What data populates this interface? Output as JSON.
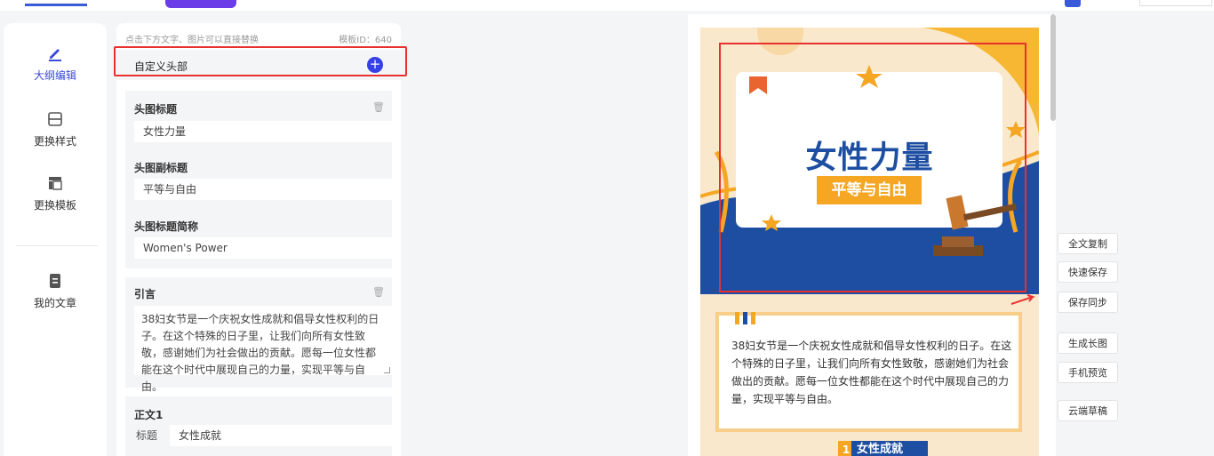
{
  "nav": {
    "items": [
      {
        "label": "大纲编辑",
        "icon": "pencil-icon"
      },
      {
        "label": "更换样式",
        "icon": "layout-rows-icon"
      },
      {
        "label": "更换模板",
        "icon": "template-icon"
      },
      {
        "label": "我的文章",
        "icon": "document-icon"
      }
    ]
  },
  "editor": {
    "hint": "点击下方文字、图片可以直接替换",
    "template_id": "模板ID：640",
    "custom_header_label": "自定义头部",
    "hero": {
      "title_label": "头图标题",
      "title_value": "女性力量",
      "subtitle_label": "头图副标题",
      "subtitle_value": "平等与自由",
      "abbr_label": "头图标题简称",
      "abbr_value": "Women's Power"
    },
    "intro": {
      "label": "引言",
      "value": "38妇女节是一个庆祝女性成就和倡导女性权利的日子。在这个特殊的日子里，让我们向所有女性致敬，感谢她们为社会做出的贡献。愿每一位女性都能在这个时代中展现自己的力量，实现平等与自由。"
    },
    "body1": {
      "label": "正文1",
      "field_label": "标题",
      "field_value": "女性成就"
    }
  },
  "preview": {
    "hero_title": "女性力量",
    "hero_subtitle": "平等与自由",
    "intro_text": "38妇女节是一个庆祝女性成就和倡导女性权利的日子。在这个特殊的日子里，让我们向所有女性致敬，感谢她们为社会做出的贡献。愿每一位女性都能在这个时代中展现自己的力量，实现平等与自由。",
    "section_num": "1",
    "section_title": "女性成就"
  },
  "actions": [
    "全文复制",
    "快速保存",
    "保存同步",
    "生成长图",
    "手机预览",
    "云端草稿"
  ],
  "colors": {
    "accent": "#3640e8",
    "highlight_border": "#e8312f",
    "brand_blue": "#1d4ea2",
    "brand_orange": "#f5a623"
  }
}
